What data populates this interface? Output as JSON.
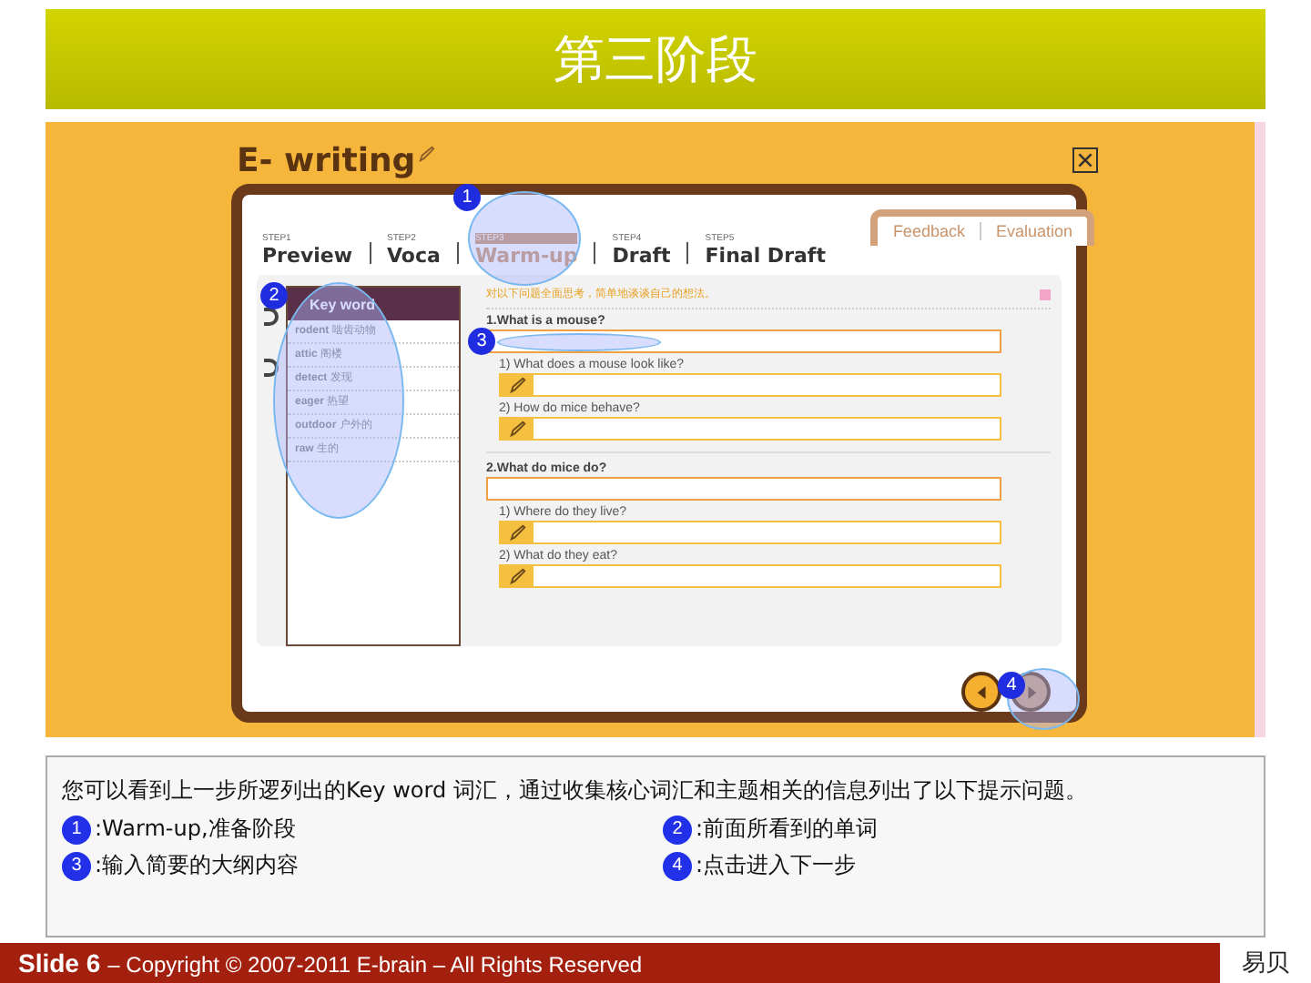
{
  "slide_title": "第三阶段",
  "app": {
    "logo": "E- writing",
    "steps": [
      {
        "step": "STEP1",
        "label": "Preview",
        "selected": false
      },
      {
        "step": "STEP2",
        "label": "Voca",
        "selected": false
      },
      {
        "step": "STEP3",
        "label": "Warm-up",
        "selected": true
      },
      {
        "step": "STEP4",
        "label": "Draft",
        "selected": false
      },
      {
        "step": "STEP5",
        "label": "Final Draft",
        "selected": false
      }
    ],
    "side_tabs": [
      "Feedback",
      "Evaluation"
    ],
    "keyword_panel": {
      "title": "Key word",
      "items": [
        {
          "word": "rodent",
          "meaning": "啮齿动物"
        },
        {
          "word": "attic",
          "meaning": "阁楼"
        },
        {
          "word": "detect",
          "meaning": "发现"
        },
        {
          "word": "eager",
          "meaning": "热望"
        },
        {
          "word": "outdoor",
          "meaning": "户外的"
        },
        {
          "word": "raw",
          "meaning": "生的"
        }
      ]
    },
    "instruction": "对以下问题全面思考，简单地谈谈自己的想法。",
    "questions": [
      {
        "text": "1.What is a mouse?",
        "sub": [
          "1) What does a mouse look like?",
          "2) How do mice behave?"
        ]
      },
      {
        "text": "2.What do mice do?",
        "sub": [
          "1) Where do they live?",
          "2) What do they eat?"
        ]
      }
    ],
    "callouts": [
      "1",
      "2",
      "3",
      "4"
    ]
  },
  "description": {
    "text": "您可以看到上一步所逻列出的Key word 词汇，通过收集核心词汇和主题相关的信息列出了以下提示问题。",
    "legend": [
      {
        "number": "1",
        "text": ":Warm-up,准备阶段"
      },
      {
        "number": "2",
        "text": ":前面所看到的单词"
      },
      {
        "number": "3",
        "text": ":输入简要的大纲内容"
      },
      {
        "number": "4",
        "text": ":点击进入下一步"
      }
    ]
  },
  "footer": {
    "slide": "Slide 6",
    "copyright": "– Copyright © 2007-2011 E-brain – All Rights Reserved",
    "logo": "易贝"
  }
}
